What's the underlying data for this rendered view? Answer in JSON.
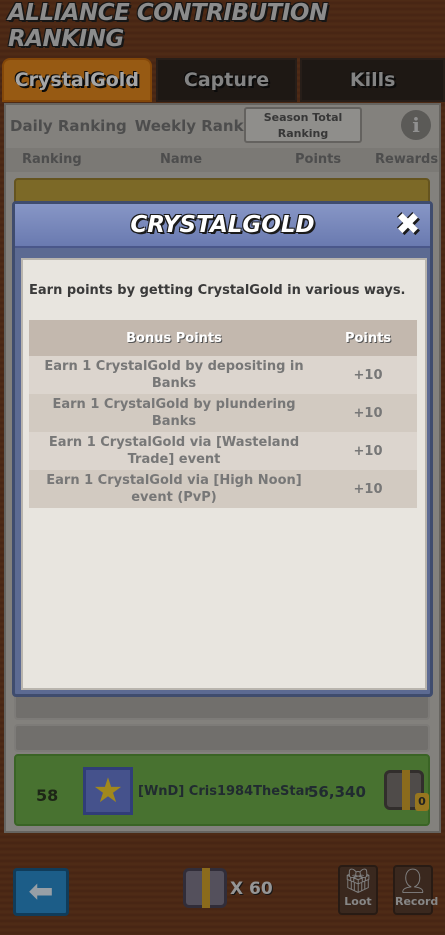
{
  "header": {
    "title": "ALLIANCE CONTRIBUTION RANKING"
  },
  "tabs": [
    {
      "label": "CrystalGold",
      "active": true
    },
    {
      "label": "Capture",
      "active": false
    },
    {
      "label": "Kills",
      "active": false
    }
  ],
  "sub_tabs": {
    "daily": "Daily Ranking",
    "weekly": "Weekly Ranking",
    "season": "Season Total Ranking"
  },
  "columns": {
    "ranking": "Ranking",
    "name": "Name",
    "points": "Points",
    "rewards": "Rewards"
  },
  "my_row": {
    "rank": "58",
    "name": "[WnD] Cris1984TheStar",
    "points": "56,340",
    "reward_count": "0"
  },
  "bottom": {
    "chest_count": "X 60",
    "loot_label": "Loot",
    "record_label": "Record"
  },
  "modal": {
    "title": "CRYSTALGOLD",
    "description": "Earn points by getting CrystalGold in various ways.",
    "table_headers": {
      "bonus": "Bonus Points",
      "points": "Points"
    },
    "rows": [
      {
        "desc": "Earn 1 CrystalGold by depositing in Banks",
        "points": "+10"
      },
      {
        "desc": "Earn 1 CrystalGold by plundering Banks",
        "points": "+10"
      },
      {
        "desc": "Earn 1 CrystalGold via [Wasteland Trade] event",
        "points": "+10"
      },
      {
        "desc": "Earn 1 CrystalGold via [High Noon] event (PvP)",
        "points": "+10"
      }
    ]
  },
  "colors": {
    "tab_active": "#e88a1e",
    "my_row_bg": "#6fb04a",
    "modal_header": "#7283b4",
    "back_button": "#2c8fd1"
  },
  "icons": [
    "info-icon",
    "close-icon",
    "back-arrow-icon",
    "chest-icon",
    "gift-icon",
    "person-icon",
    "star-avatar-icon"
  ]
}
